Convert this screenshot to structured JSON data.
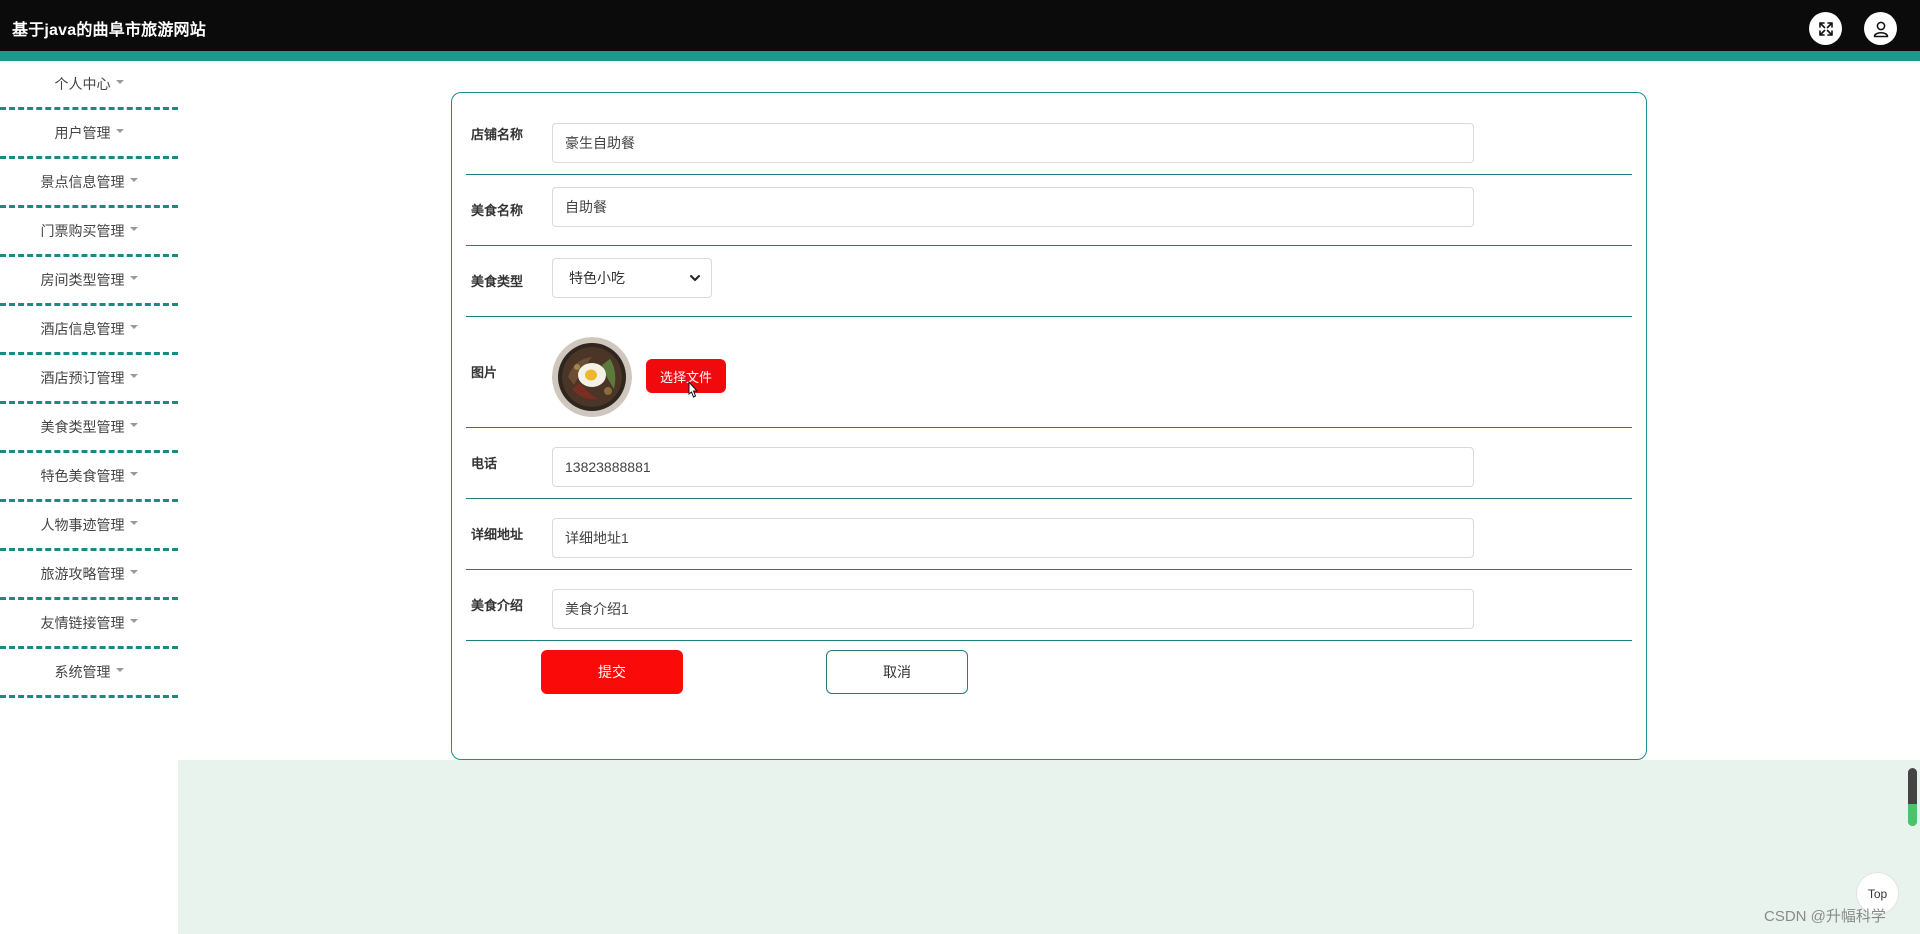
{
  "app": {
    "title": "基于java的曲阜市旅游网站"
  },
  "header": {
    "icons": [
      "fullscreen-icon",
      "user-icon"
    ]
  },
  "sidebar": {
    "items": [
      {
        "label": "个人中心"
      },
      {
        "label": "用户管理"
      },
      {
        "label": "景点信息管理"
      },
      {
        "label": "门票购买管理"
      },
      {
        "label": "房间类型管理"
      },
      {
        "label": "酒店信息管理"
      },
      {
        "label": "酒店预订管理"
      },
      {
        "label": "美食类型管理"
      },
      {
        "label": "特色美食管理"
      },
      {
        "label": "人物事迹管理"
      },
      {
        "label": "旅游攻略管理"
      },
      {
        "label": "友情链接管理"
      },
      {
        "label": "系统管理"
      }
    ]
  },
  "form": {
    "shop_name": {
      "label": "店铺名称",
      "value": "豪生自助餐"
    },
    "food_name": {
      "label": "美食名称",
      "value": "自助餐"
    },
    "food_type": {
      "label": "美食类型",
      "selected": "特色小吃"
    },
    "picture": {
      "label": "图片",
      "button": "选择文件"
    },
    "phone": {
      "label": "电话",
      "value": "13823888881"
    },
    "address": {
      "label": "详细地址",
      "value": "详细地址1"
    },
    "intro": {
      "label": "美食介绍",
      "value": "美食介绍1"
    },
    "submit_label": "提交",
    "cancel_label": "取消"
  },
  "page": {
    "top_button": "Top",
    "watermark": "CSDN @升幅科学"
  },
  "colors": {
    "topbar": "#0b0b0b",
    "accent": "#1b9a8b",
    "danger": "#f0090d",
    "border": "#1f7f80",
    "lower_bg": "#e9f3ee"
  }
}
